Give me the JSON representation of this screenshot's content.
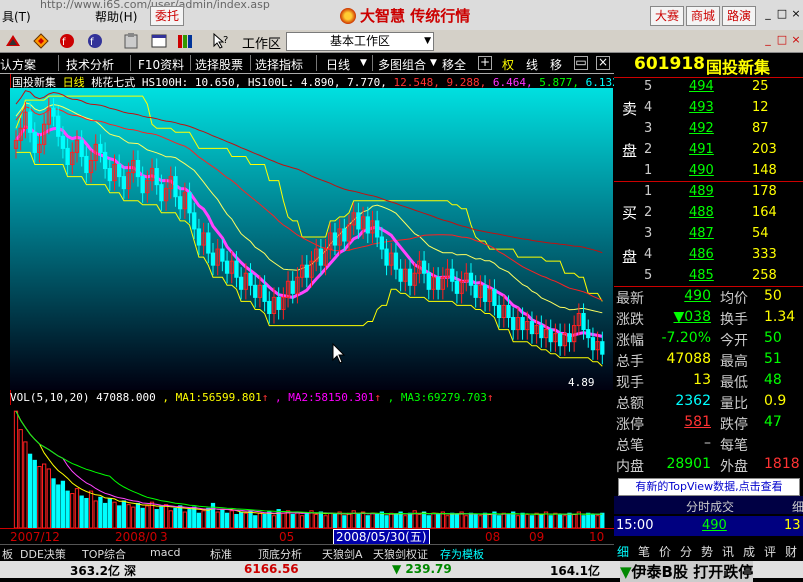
{
  "menubar": {
    "items": [
      "具(T)",
      "帮助(H)"
    ],
    "url_fragment": "http://www.i6S.com/user/admin/index.asp",
    "wt_label": "委托",
    "brand": "大智慧 传统行情",
    "buttons": [
      "大赛",
      "商城",
      "路演"
    ],
    "window_controls": [
      "_",
      "□",
      "×"
    ]
  },
  "toolbar": {
    "workarea_label": "工作区",
    "workarea_value": "基本工作区",
    "right_controls": [
      "_",
      "□",
      "×"
    ]
  },
  "toolbar2": {
    "items": [
      "认方案",
      "技术分析",
      "F10资料",
      "选择股票",
      "选择指标",
      "日线",
      "多图组合",
      "移全"
    ],
    "icons": [
      "权",
      "线",
      "移"
    ]
  },
  "stock": {
    "code": "601918",
    "name": "国投新集"
  },
  "chart_header": {
    "name": "国投新集",
    "period": "日线",
    "indicator": "桃花七式",
    "params": [
      {
        "label": "HS100H:",
        "value": "10.650",
        "color": "#ffffff"
      },
      {
        "label": "HS100L:",
        "value": "4.890",
        "color": "#ffffff"
      },
      {
        "label": "",
        "value": "7.770",
        "color": "#ffffff"
      },
      {
        "label": "",
        "value": "12.548",
        "color": "#ff3333"
      },
      {
        "label": "",
        "value": "9.288",
        "color": "#ff3333"
      },
      {
        "label": "",
        "value": "6.464",
        "color": "#ff33ff"
      },
      {
        "label": "",
        "value": "5.877",
        "color": "#00ff00"
      },
      {
        "label": "",
        "value": "6.132",
        "color": "#00ffff"
      }
    ]
  },
  "volume_header": {
    "label": "VOL(5,10,20)",
    "vol": "47088.000",
    "ma1_label": "MA1:",
    "ma1": "56599.801",
    "ma2_label": "MA2:",
    "ma2": "58150.301",
    "ma3_label": "MA3:",
    "ma3": "69279.703"
  },
  "chart_data": {
    "type": "candlestick",
    "price_label": "4.89",
    "ylim": [
      4.0,
      11.5
    ],
    "x_labels": [
      "2007/12",
      "2008/0",
      "3",
      "05",
      "2008/05/30(五)",
      "08",
      "09",
      "10"
    ],
    "closes": [
      10.2,
      10.5,
      10.9,
      10.4,
      9.9,
      10.1,
      10.6,
      11.0,
      10.8,
      10.3,
      10.0,
      9.6,
      9.9,
      10.2,
      9.8,
      9.4,
      9.7,
      10.1,
      9.9,
      9.5,
      9.2,
      9.6,
      9.3,
      9.0,
      9.4,
      9.7,
      9.3,
      8.9,
      9.2,
      9.5,
      9.1,
      8.7,
      9.0,
      9.3,
      8.8,
      8.5,
      8.9,
      8.4,
      8.0,
      7.6,
      7.9,
      7.4,
      7.1,
      7.5,
      7.2,
      6.9,
      7.2,
      6.8,
      6.5,
      6.9,
      6.6,
      6.3,
      6.6,
      6.2,
      5.9,
      6.3,
      6.0,
      6.3,
      6.7,
      6.4,
      6.8,
      7.1,
      6.8,
      7.2,
      7.5,
      7.1,
      7.5,
      7.9,
      7.6,
      8.0,
      7.7,
      8.1,
      8.4,
      8.0,
      8.3,
      7.9,
      8.2,
      7.8,
      7.5,
      7.1,
      7.4,
      7.0,
      6.7,
      7.0,
      6.6,
      6.9,
      7.2,
      6.9,
      6.5,
      6.8,
      6.5,
      6.8,
      7.0,
      6.7,
      6.4,
      6.7,
      6.9,
      6.6,
      6.3,
      6.6,
      6.2,
      6.5,
      6.1,
      5.8,
      6.1,
      5.8,
      5.5,
      5.8,
      5.5,
      5.7,
      5.4,
      5.6,
      5.3,
      5.5,
      5.2,
      5.4,
      5.1,
      5.4,
      5.2,
      5.6,
      5.9,
      5.5,
      5.3,
      5.0,
      5.2,
      4.89
    ],
    "volumes": [
      95,
      80,
      70,
      60,
      55,
      50,
      52,
      48,
      40,
      35,
      38,
      30,
      28,
      32,
      26,
      24,
      30,
      22,
      25,
      20,
      24,
      21,
      18,
      22,
      19,
      17,
      20,
      16,
      18,
      21,
      15,
      17,
      19,
      14,
      16,
      18,
      13,
      15,
      17,
      12,
      14,
      16,
      20,
      13,
      15,
      12,
      14,
      11,
      13,
      12,
      14,
      10,
      12,
      11,
      13,
      10,
      15,
      12,
      14,
      11,
      13,
      10,
      12,
      14,
      11,
      13,
      10,
      12,
      11,
      13,
      10,
      12,
      14,
      11,
      13,
      10,
      12,
      11,
      13,
      10,
      12,
      11,
      13,
      10,
      12,
      14,
      11,
      13,
      10,
      12,
      11,
      13,
      10,
      12,
      11,
      13,
      10,
      12,
      11,
      10,
      12,
      11,
      13,
      10,
      12,
      11,
      13,
      10,
      12,
      11,
      10,
      12,
      11,
      13,
      10,
      12,
      11,
      10,
      12,
      11,
      13,
      10,
      12,
      11,
      10,
      12
    ],
    "vol_ylim": [
      0,
      100
    ]
  },
  "dateaxis": {
    "labels": [
      "2007/12",
      "2008/0",
      "3",
      "05",
      "08",
      "09",
      "10"
    ],
    "highlight": "2008/05/30(五)"
  },
  "bottom_tabs": [
    "板",
    "DDE决策",
    "TOP综合",
    "macd",
    "标准",
    "顶底分析",
    "天狼剑A",
    "天狼剑权证",
    "存为模板"
  ],
  "orderbook": {
    "sell_side_label_1": "卖",
    "sell_side_label_2": "盘",
    "buy_side_label_1": "买",
    "buy_side_label_2": "盘",
    "sell": [
      {
        "lvl": "5",
        "price": "494",
        "vol": "25"
      },
      {
        "lvl": "4",
        "price": "493",
        "vol": "12"
      },
      {
        "lvl": "3",
        "price": "492",
        "vol": "87"
      },
      {
        "lvl": "2",
        "price": "491",
        "vol": "203"
      },
      {
        "lvl": "1",
        "price": "490",
        "vol": "148"
      }
    ],
    "buy": [
      {
        "lvl": "1",
        "price": "489",
        "vol": "178"
      },
      {
        "lvl": "2",
        "price": "488",
        "vol": "164"
      },
      {
        "lvl": "3",
        "price": "487",
        "vol": "54"
      },
      {
        "lvl": "4",
        "price": "486",
        "vol": "333"
      },
      {
        "lvl": "5",
        "price": "485",
        "vol": "258"
      }
    ]
  },
  "quotes": [
    {
      "l": "最新",
      "lv": "490",
      "lc": "#00ff00",
      "lu": true,
      "r": "均价",
      "rv": "50",
      "rc": "#ffff00"
    },
    {
      "l": "涨跌",
      "lv": "▼038",
      "lc": "#00ff00",
      "lu": true,
      "r": "换手",
      "rv": "1.34",
      "rc": "#ffff00"
    },
    {
      "l": "涨幅",
      "lv": "-7.20%",
      "lc": "#00ff00",
      "lu": false,
      "r": "今开",
      "rv": "50",
      "rc": "#00ff00"
    },
    {
      "l": "总手",
      "lv": "47088",
      "lc": "#ffff00",
      "lu": false,
      "r": "最高",
      "rv": "51",
      "rc": "#00ff00"
    },
    {
      "l": "现手",
      "lv": "13",
      "lc": "#ffff00",
      "lu": false,
      "r": "最低",
      "rv": "48",
      "rc": "#00ff00"
    },
    {
      "l": "总额",
      "lv": "2362",
      "lc": "#00ffff",
      "lu": false,
      "r": "量比",
      "rv": "0.9",
      "rc": "#ffff00"
    },
    {
      "l": "涨停",
      "lv": "581",
      "lc": "#ff3333",
      "lu": true,
      "r": "跌停",
      "rv": "47",
      "rc": "#00ff00"
    },
    {
      "l": "总笔",
      "lv": "–",
      "lc": "#cccccc",
      "lu": false,
      "r": "每笔",
      "rv": "",
      "rc": "#cccccc"
    },
    {
      "l": "内盘",
      "lv": "28901",
      "lc": "#00ff00",
      "lu": false,
      "r": "外盘",
      "rv": "1818",
      "rc": "#ff3333"
    }
  ],
  "notice": "有新的TopView数据,点击查看",
  "trades": {
    "head": "分时成交",
    "head2": "细",
    "time": "15:00",
    "price": "490",
    "vol": "13"
  },
  "right_tabs": [
    "细",
    "笔",
    "价",
    "分",
    "势",
    "讯",
    "成",
    "评",
    "财"
  ],
  "statusbar": {
    "v1": "363.2亿",
    "v1b": "深",
    "v2": "6166.56",
    "v3": "▼ 239.79",
    "v4": "164.1亿",
    "ticker": "伊泰B股 打开跌停"
  }
}
